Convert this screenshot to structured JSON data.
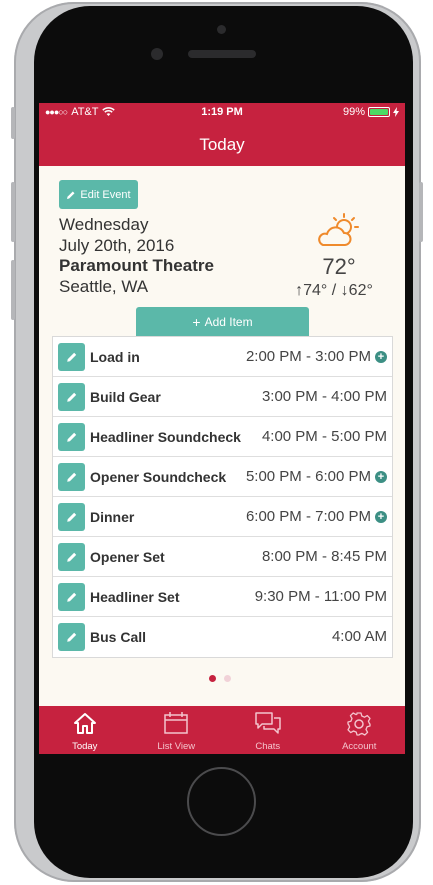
{
  "status_bar": {
    "carrier": "AT&T",
    "time": "1:19 PM",
    "battery": "99%"
  },
  "nav": {
    "title": "Today"
  },
  "event": {
    "edit_label": "Edit Event",
    "day": "Wednesday",
    "date": "July 20th, 2016",
    "venue": "Paramount Theatre",
    "city": "Seattle, WA"
  },
  "weather": {
    "icon": "partly-cloudy-icon",
    "temp": "72°",
    "high": "74°",
    "low": "62°"
  },
  "add_item_label": "Add Item",
  "schedule": [
    {
      "name": "Load in",
      "time": "2:00 PM - 3:00 PM",
      "has_plus": true
    },
    {
      "name": "Build Gear",
      "time": "3:00 PM - 4:00 PM",
      "has_plus": false
    },
    {
      "name": "Headliner Soundcheck",
      "time": "4:00 PM - 5:00 PM",
      "has_plus": false
    },
    {
      "name": "Opener Soundcheck",
      "time": "5:00 PM - 6:00 PM",
      "has_plus": true
    },
    {
      "name": "Dinner",
      "time": "6:00 PM - 7:00 PM",
      "has_plus": true
    },
    {
      "name": "Opener Set",
      "time": "8:00 PM - 8:45 PM",
      "has_plus": false
    },
    {
      "name": "Headliner Set",
      "time": "9:30 PM - 11:00 PM",
      "has_plus": false
    },
    {
      "name": "Bus Call",
      "time": "4:00 AM",
      "has_plus": false
    }
  ],
  "pager": {
    "current": 1,
    "total": 2
  },
  "tabs": [
    {
      "label": "Today",
      "icon": "home-icon",
      "active": true
    },
    {
      "label": "List View",
      "icon": "calendar-icon",
      "active": false
    },
    {
      "label": "Chats",
      "icon": "chat-bubbles-icon",
      "active": false
    },
    {
      "label": "Account",
      "icon": "gear-icon",
      "active": false
    }
  ],
  "colors": {
    "brand_red": "#c6223f",
    "teal": "#5bb8a9",
    "background": "#fcf9f2"
  }
}
